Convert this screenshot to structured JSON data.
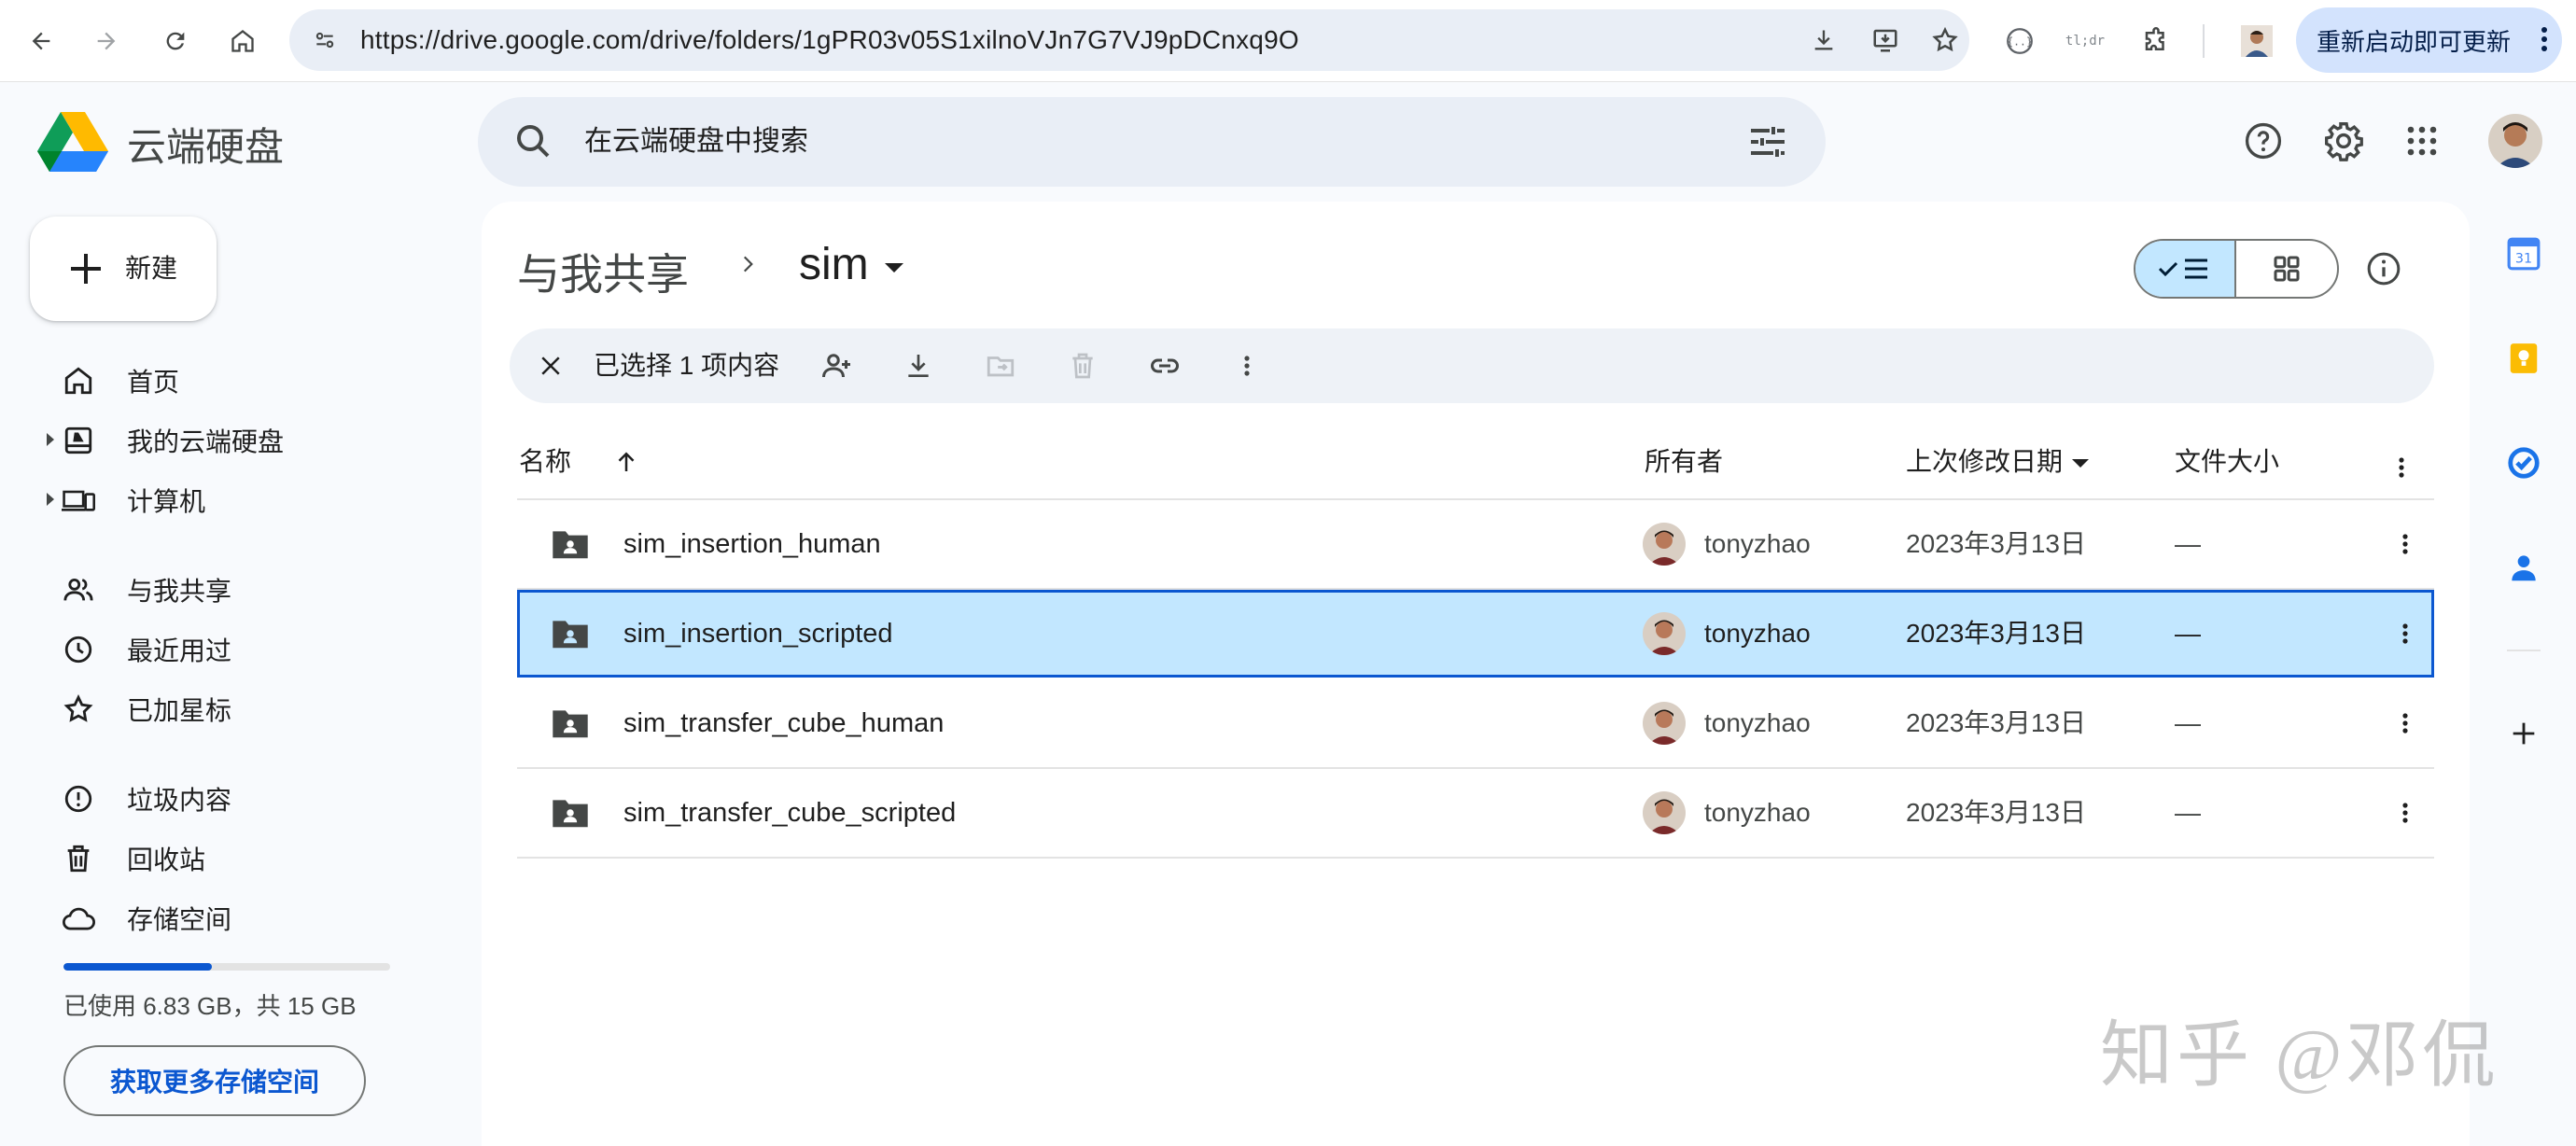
{
  "browser": {
    "url": "https://drive.google.com/drive/folders/1gPR03v05S1xilnoVJn7G7VJ9pDCnxq9O",
    "update_button": "重新启动即可更新",
    "ext_badge": "tl;dr"
  },
  "app": {
    "title": "云端硬盘",
    "search_placeholder": "在云端硬盘中搜索"
  },
  "sidebar": {
    "new_label": "新建",
    "items": [
      {
        "label": "首页",
        "icon": "home-icon"
      },
      {
        "label": "我的云端硬盘",
        "icon": "my-drive-icon"
      },
      {
        "label": "计算机",
        "icon": "computers-icon"
      },
      {
        "label": "与我共享",
        "icon": "shared-icon"
      },
      {
        "label": "最近用过",
        "icon": "recent-icon"
      },
      {
        "label": "已加星标",
        "icon": "star-icon"
      },
      {
        "label": "垃圾内容",
        "icon": "spam-icon"
      },
      {
        "label": "回收站",
        "icon": "trash-icon"
      },
      {
        "label": "存储空间",
        "icon": "cloud-icon"
      }
    ],
    "storage": {
      "text": "已使用 6.83 GB，共 15 GB",
      "used_fraction": 0.455,
      "button": "获取更多存储空间"
    }
  },
  "breadcrumb": {
    "root": "与我共享",
    "current": "sim"
  },
  "selection_bar": {
    "count_text": "已选择 1 项内容"
  },
  "table": {
    "headers": {
      "name": "名称",
      "owner": "所有者",
      "modified": "上次修改日期",
      "size": "文件大小"
    },
    "rows": [
      {
        "name": "sim_insertion_human",
        "owner": "tonyzhao",
        "modified": "2023年3月13日",
        "size": "—",
        "selected": false
      },
      {
        "name": "sim_insertion_scripted",
        "owner": "tonyzhao",
        "modified": "2023年3月13日",
        "size": "—",
        "selected": true
      },
      {
        "name": "sim_transfer_cube_human",
        "owner": "tonyzhao",
        "modified": "2023年3月13日",
        "size": "—",
        "selected": false
      },
      {
        "name": "sim_transfer_cube_scripted",
        "owner": "tonyzhao",
        "modified": "2023年3月13日",
        "size": "—",
        "selected": false
      }
    ]
  },
  "watermark": "知乎 @邓侃",
  "colors": {
    "accent": "#0b57d0",
    "selected_row": "#c2e7ff",
    "search_bg": "#e9eef6",
    "page_bg": "#f8fafd"
  }
}
